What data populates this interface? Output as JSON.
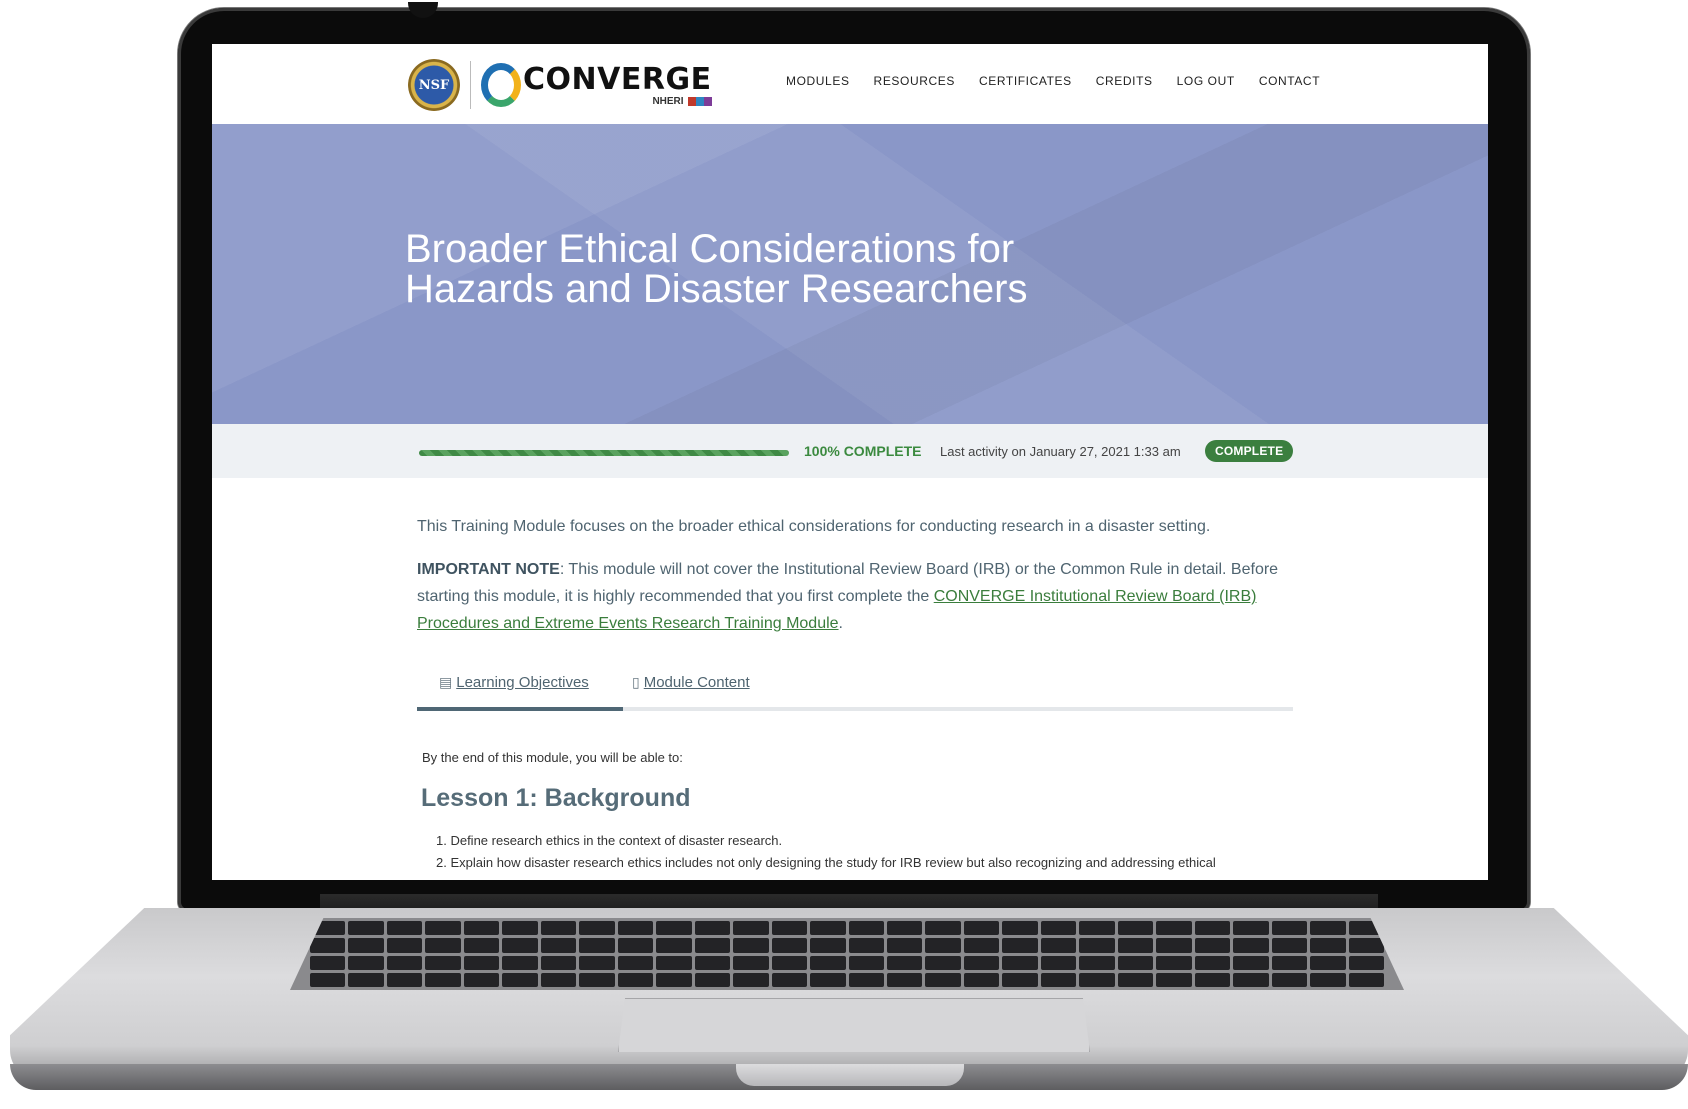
{
  "header": {
    "nsf_seal_text": "NSF",
    "brand_name": "CONVERGE",
    "brand_sub": "NHERI",
    "nav": [
      "MODULES",
      "RESOURCES",
      "CERTIFICATES",
      "CREDITS",
      "LOG OUT",
      "CONTACT"
    ]
  },
  "hero": {
    "title_line1": "Broader Ethical Considerations for",
    "title_line2": "Hazards and Disaster Researchers"
  },
  "progress": {
    "percent": 100,
    "percent_label": "100% COMPLETE",
    "last_activity": "Last activity on January 27, 2021 1:33 am",
    "status": "COMPLETE"
  },
  "content": {
    "intro": "This Training Module focuses on the broader ethical considerations for conducting research in a disaster setting.",
    "note_label": "IMPORTANT NOTE",
    "note_text": ": This module will not cover the Institutional Review Board (IRB) or the Common Rule in detail. Before starting this module, it is highly recommended that you first complete the ",
    "note_link": "CONVERGE Institutional Review Board (IRB) Procedures and Extreme Events Research Training Module",
    "note_end": "."
  },
  "tabs": [
    {
      "label": " Learning Objectives",
      "icon": "document-icon",
      "active": true
    },
    {
      "label": " Module Content",
      "icon": "book-icon",
      "active": false
    }
  ],
  "objectives": {
    "lead": "By the end of this module, you will be able to:",
    "lesson_title": "Lesson 1: Background",
    "items": [
      "1. Define research ethics in the context of disaster research.",
      "2. Explain how disaster research ethics includes not only designing the study for IRB review but also recognizing and addressing ethical"
    ]
  },
  "colors": {
    "hero_bg": "#8a97c8",
    "accent_green": "#3b7f3f",
    "text_slate": "#4f6470"
  }
}
